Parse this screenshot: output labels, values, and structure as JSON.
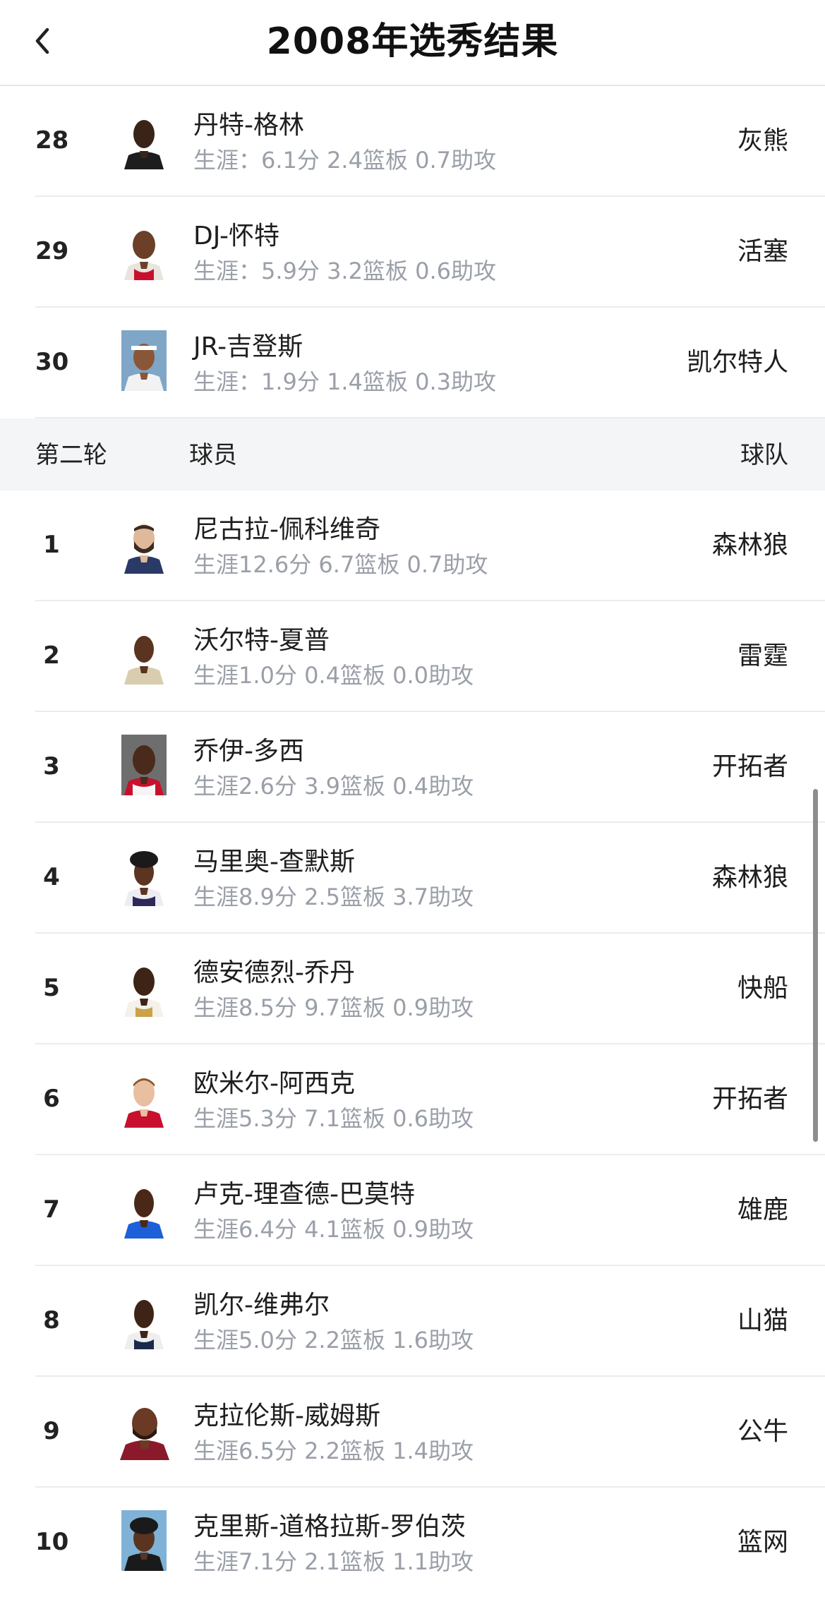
{
  "header": {
    "title": "2008年选秀结果",
    "back_icon": "chevron-left-icon"
  },
  "round1_tail": [
    {
      "pick": "28",
      "name": "丹特-格林",
      "stats": "生涯：6.1分 2.4篮板 0.7助攻",
      "team": "灰熊"
    },
    {
      "pick": "29",
      "name": "DJ-怀特",
      "stats": "生涯：5.9分 3.2篮板 0.6助攻",
      "team": "活塞"
    },
    {
      "pick": "30",
      "name": "JR-吉登斯",
      "stats": "生涯：1.9分 1.4篮板 0.3助攻",
      "team": "凯尔特人"
    }
  ],
  "section": {
    "round": "第二轮",
    "player": "球员",
    "team": "球队"
  },
  "round2": [
    {
      "pick": "1",
      "name": "尼古拉-佩科维奇",
      "stats": "生涯12.6分 6.7篮板 0.7助攻",
      "team": "森林狼"
    },
    {
      "pick": "2",
      "name": "沃尔特-夏普",
      "stats": "生涯1.0分 0.4篮板 0.0助攻",
      "team": "雷霆"
    },
    {
      "pick": "3",
      "name": "乔伊-多西",
      "stats": "生涯2.6分 3.9篮板 0.4助攻",
      "team": "开拓者"
    },
    {
      "pick": "4",
      "name": "马里奥-查默斯",
      "stats": "生涯8.9分 2.5篮板 3.7助攻",
      "team": "森林狼"
    },
    {
      "pick": "5",
      "name": "德安德烈-乔丹",
      "stats": "生涯8.5分 9.7篮板 0.9助攻",
      "team": "快船"
    },
    {
      "pick": "6",
      "name": "欧米尔-阿西克",
      "stats": "生涯5.3分 7.1篮板 0.6助攻",
      "team": "开拓者"
    },
    {
      "pick": "7",
      "name": "卢克-理查德-巴莫特",
      "stats": "生涯6.4分 4.1篮板 0.9助攻",
      "team": "雄鹿"
    },
    {
      "pick": "8",
      "name": "凯尔-维弗尔",
      "stats": "生涯5.0分 2.2篮板 1.6助攻",
      "team": "山猫"
    },
    {
      "pick": "9",
      "name": "克拉伦斯-威姆斯",
      "stats": "生涯6.5分 2.2篮板 1.4助攻",
      "team": "公牛"
    },
    {
      "pick": "10",
      "name": "克里斯-道格拉斯-罗伯茨",
      "stats": "生涯7.1分 2.1篮板 1.1助攻",
      "team": "篮网"
    }
  ],
  "colors": {
    "accent_text": "#1e1e1e",
    "muted_text": "#9a9fa8",
    "section_bg": "#f4f5f7",
    "divider": "#ececec"
  }
}
